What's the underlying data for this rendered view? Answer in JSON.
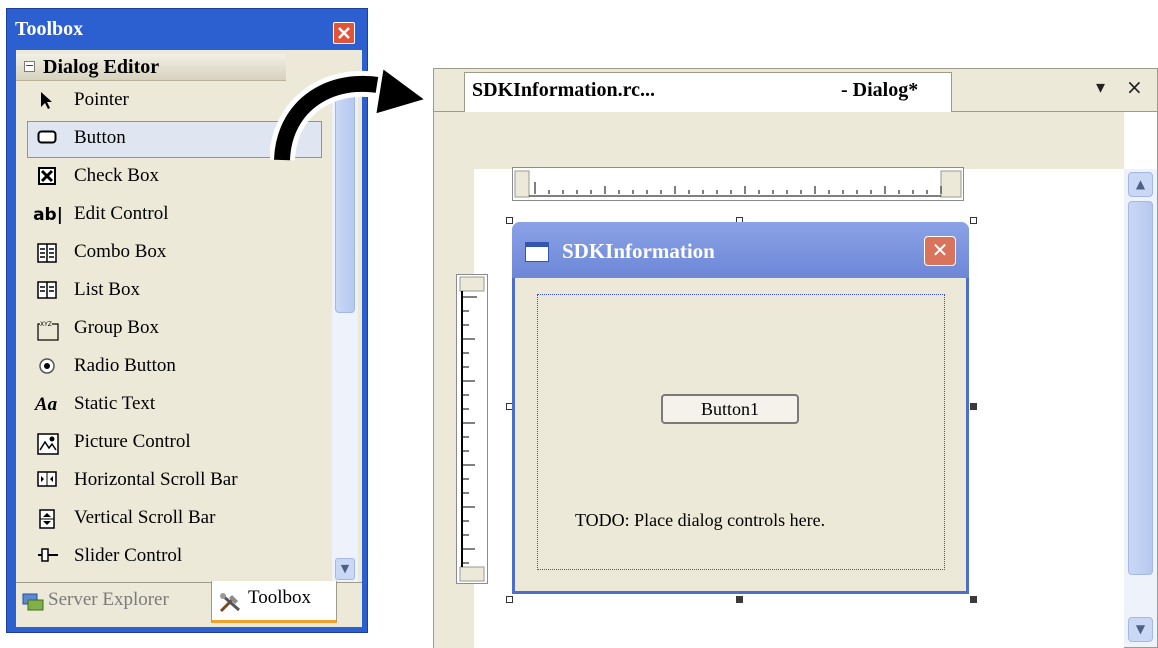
{
  "toolbox": {
    "title": "Toolbox",
    "section": "Dialog Editor",
    "section_toggle": "−",
    "items": [
      {
        "label": "Pointer",
        "icon": "pointer-icon",
        "glyph": "➤"
      },
      {
        "label": "Button",
        "icon": "button-icon",
        "glyph": "▭"
      },
      {
        "label": "Check Box",
        "icon": "check-box-icon",
        "glyph": "☒"
      },
      {
        "label": "Edit Control",
        "icon": "edit-control-icon",
        "glyph": "ab|"
      },
      {
        "label": "Combo Box",
        "icon": "combo-box-icon",
        "glyph": "⊟"
      },
      {
        "label": "List Box",
        "icon": "list-box-icon",
        "glyph": "⊞"
      },
      {
        "label": "Group Box",
        "icon": "group-box-icon",
        "glyph": "⬚"
      },
      {
        "label": "Radio Button",
        "icon": "radio-button-icon",
        "glyph": "◉"
      },
      {
        "label": "Static Text",
        "icon": "static-text-icon",
        "glyph": "Aa"
      },
      {
        "label": "Picture Control",
        "icon": "picture-control-icon",
        "glyph": "▦"
      },
      {
        "label": "Horizontal Scroll Bar",
        "icon": "horizontal-scroll-bar-icon",
        "glyph": "◧"
      },
      {
        "label": "Vertical Scroll Bar",
        "icon": "vertical-scroll-bar-icon",
        "glyph": "⬓"
      },
      {
        "label": "Slider Control",
        "icon": "slider-control-icon",
        "glyph": "⊸"
      }
    ],
    "selected_item": "Button",
    "tabs": {
      "server_explorer": "Server Explorer",
      "toolbox": "Toolbox"
    }
  },
  "editor": {
    "tab_title": "SDKInformation.rc...",
    "tab_mode": "- Dialog*",
    "menu_glyph": "▾",
    "close_glyph": "×",
    "dialog": {
      "title": "SDKInformation",
      "close_glyph": "✕",
      "button_label": "Button1",
      "todo_text": "TODO: Place dialog controls here."
    }
  },
  "colors": {
    "toolbox_frame": "#2c5fd0",
    "panel_background": "#ece9d8",
    "selection_border": "#7897c4",
    "dialog_title_bar": "#6d87d7",
    "active_tab_accent": "#f0a22c"
  }
}
